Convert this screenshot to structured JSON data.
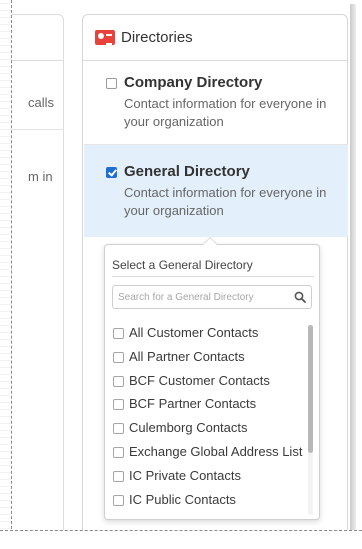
{
  "left_panel": {
    "fragment_1": "calls",
    "fragment_2": "m in"
  },
  "directories": {
    "title": "Directories",
    "icon": "directory-card-icon",
    "accent_color": "#e8433a",
    "options": [
      {
        "name": "Company Directory",
        "description": "Contact information for everyone in your organization",
        "checked": false
      },
      {
        "name": "General Directory",
        "description": "Contact information for everyone in your organization",
        "checked": true
      }
    ]
  },
  "general_directory_popup": {
    "label": "Select a General Directory",
    "search_placeholder": "Search for a General Directory",
    "items": [
      "All Customer Contacts",
      "All Partner Contacts",
      "BCF Customer Contacts",
      "BCF Partner Contacts",
      "Culemborg Contacts",
      "Exchange Global Address List",
      "IC Private Contacts",
      "IC Public Contacts"
    ]
  }
}
